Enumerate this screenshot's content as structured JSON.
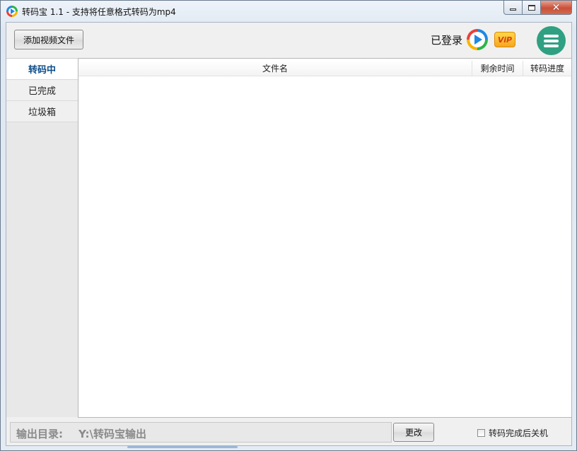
{
  "window": {
    "title": "转码宝 1.1 - 支持将任意格式转码为mp4"
  },
  "toolbar": {
    "add_video_label": "添加视频文件",
    "login_status": "已登录",
    "vip_label": "ViP"
  },
  "sidebar": {
    "items": [
      {
        "label": "转码中",
        "active": true
      },
      {
        "label": "已完成",
        "active": false
      },
      {
        "label": "垃圾箱",
        "active": false
      }
    ]
  },
  "file_list": {
    "columns": {
      "filename": "文件名",
      "remaining_time": "剩余时间",
      "progress": "转码进度"
    },
    "rows": []
  },
  "bottom": {
    "output_dir_label": "输出目录:",
    "output_dir_path": "Y:\\转码宝输出",
    "change_label": "更改",
    "shutdown_label": "转码完成后关机",
    "shutdown_checked": false
  },
  "colors": {
    "menu_button": "#2fa081",
    "active_tab_text": "#0b4c8a",
    "vip_gold": "#f5a623"
  },
  "icons": [
    "app-logo-icon",
    "play-logo-icon",
    "vip-badge-icon",
    "hamburger-menu-icon",
    "minimize-icon",
    "maximize-icon",
    "close-icon"
  ]
}
